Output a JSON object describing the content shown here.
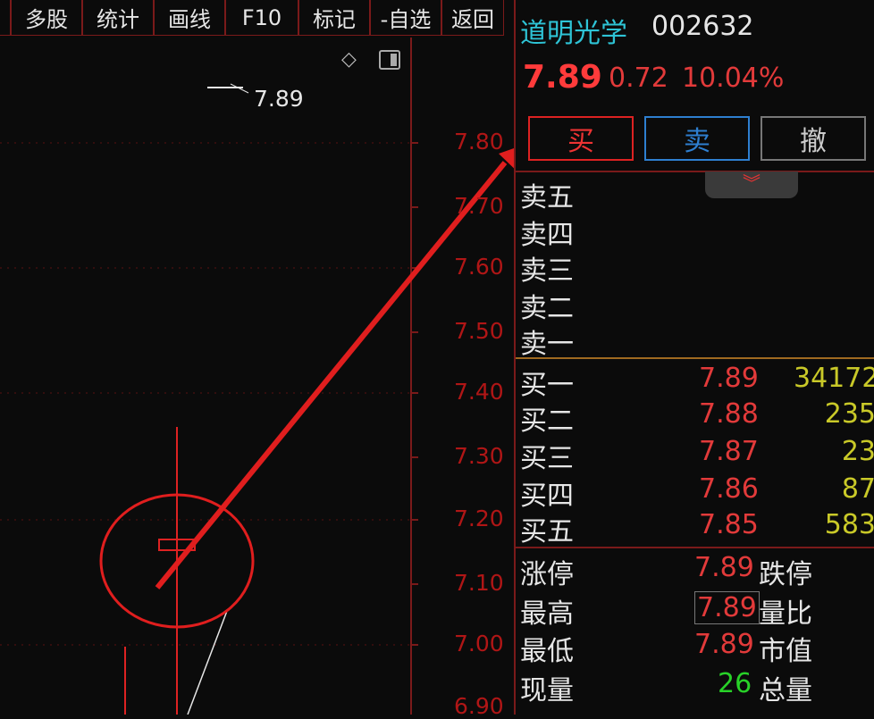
{
  "toolbar": {
    "items": [
      "多股",
      "统计",
      "画线",
      "F10",
      "标记",
      "-自选",
      "返回"
    ]
  },
  "chart": {
    "price_note": "7.89",
    "axis_labels": [
      "7.80",
      "7.70",
      "7.60",
      "7.50",
      "7.40",
      "7.30",
      "7.20",
      "7.10",
      "7.00",
      "6.90"
    ],
    "colors": {
      "axis": "#b01616",
      "annotation": "#e01e1e"
    }
  },
  "quote": {
    "name": "道明光学",
    "code": "002632",
    "price": "7.89",
    "change": "0.72",
    "change_pct": "10.04%"
  },
  "actions": {
    "buy": "买",
    "sell": "卖",
    "cancel": "撤"
  },
  "collapse_icon": "chevron-double-down-icon",
  "asks": [
    {
      "label": "卖五"
    },
    {
      "label": "卖四"
    },
    {
      "label": "卖三"
    },
    {
      "label": "卖二"
    },
    {
      "label": "卖一"
    }
  ],
  "bids": [
    {
      "label": "买一",
      "price": "7.89",
      "volume": "34172"
    },
    {
      "label": "买二",
      "price": "7.88",
      "volume": "235"
    },
    {
      "label": "买三",
      "price": "7.87",
      "volume": "23"
    },
    {
      "label": "买四",
      "price": "7.86",
      "volume": "87"
    },
    {
      "label": "买五",
      "price": "7.85",
      "volume": "583"
    }
  ],
  "stats": {
    "limit_up": {
      "label": "涨停",
      "value": "7.89"
    },
    "limit_down": {
      "label": "跌停"
    },
    "high": {
      "label": "最高",
      "value": "7.89"
    },
    "volume_ratio": {
      "label": "量比"
    },
    "low": {
      "label": "最低",
      "value": "7.89"
    },
    "market_cap": {
      "label": "市值"
    },
    "current_volume": {
      "label": "现量",
      "value": "26"
    },
    "total_volume": {
      "label": "总量"
    }
  }
}
